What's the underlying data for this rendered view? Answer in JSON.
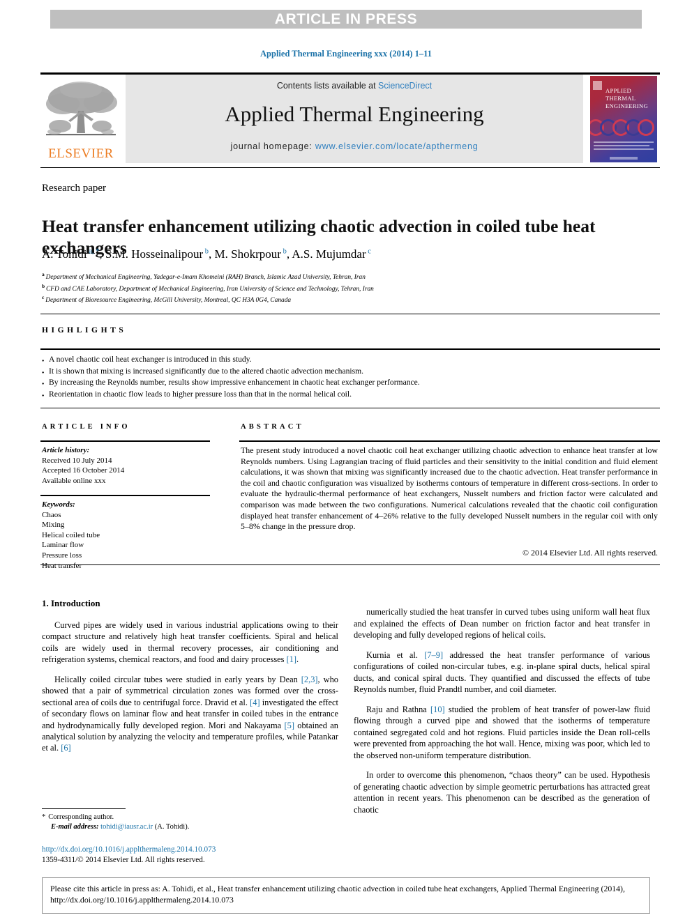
{
  "banner": {
    "text": "ARTICLE IN PRESS"
  },
  "journal_line": "Applied Thermal Engineering xxx (2014) 1–11",
  "masthead": {
    "elsevier_wordmark": "ELSEVIER",
    "contents_prefix": "Contents lists available at ",
    "contents_link": "ScienceDirect",
    "journal_title": "Applied Thermal Engineering",
    "homepage_prefix": "journal homepage: ",
    "homepage_url": "www.elsevier.com/locate/apthermeng",
    "cover_title_line1": "APPLIED",
    "cover_title_line2": "THERMAL",
    "cover_title_line3": "ENGINEERING"
  },
  "article": {
    "kicker": "Research paper",
    "title": "Heat transfer enhancement utilizing chaotic advection in coiled tube heat exchangers",
    "authors": [
      {
        "name": "A. Tohidi",
        "marks": "a, *"
      },
      {
        "name": "S.M. Hosseinalipour",
        "marks": "b"
      },
      {
        "name": "M. Shokrpour",
        "marks": "b"
      },
      {
        "name": "A.S. Mujumdar",
        "marks": "c"
      }
    ],
    "affiliations": [
      {
        "mark": "a",
        "text": "Department of Mechanical Engineering, Yadegar-e-Imam Khomeini (RAH) Branch, Islamic Azad University, Tehran, Iran"
      },
      {
        "mark": "b",
        "text": "CFD and CAE Laboratory, Department of Mechanical Engineering, Iran University of Science and Technology, Tehran, Iran"
      },
      {
        "mark": "c",
        "text": "Department of Bioresource Engineering, McGill University, Montreal, QC H3A 0G4, Canada"
      }
    ]
  },
  "highlights": {
    "heading": "HIGHLIGHTS",
    "items": [
      "A novel chaotic coil heat exchanger is introduced in this study.",
      "It is shown that mixing is increased significantly due to the altered chaotic advection mechanism.",
      "By increasing the Reynolds number, results show impressive enhancement in chaotic heat exchanger performance.",
      "Reorientation in chaotic flow leads to higher pressure loss than that in the normal helical coil."
    ]
  },
  "article_info": {
    "heading": "ARTICLE INFO",
    "history_label": "Article history:",
    "history": [
      "Received 10 July 2014",
      "Accepted 16 October 2014",
      "Available online xxx"
    ],
    "keywords_label": "Keywords:",
    "keywords": [
      "Chaos",
      "Mixing",
      "Helical coiled tube",
      "Laminar flow",
      "Pressure loss",
      "Heat transfer"
    ]
  },
  "abstract": {
    "heading": "ABSTRACT",
    "text": "The present study introduced a novel chaotic coil heat exchanger utilizing chaotic advection to enhance heat transfer at low Reynolds numbers. Using Lagrangian tracing of fluid particles and their sensitivity to the initial condition and fluid element calculations, it was shown that mixing was significantly increased due to the chaotic advection. Heat transfer performance in the coil and chaotic configuration was visualized by isotherms contours of temperature in different cross-sections. In order to evaluate the hydraulic-thermal performance of heat exchangers, Nusselt numbers and friction factor were calculated and comparison was made between the two configurations. Numerical calculations revealed that the chaotic coil configuration displayed heat transfer enhancement of 4–26% relative to the fully developed Nusselt numbers in the regular coil with only 5–8% change in the pressure drop.",
    "copyright": "© 2014 Elsevier Ltd. All rights reserved."
  },
  "body": {
    "section_heading": "1. Introduction",
    "left_paragraphs": [
      "Curved pipes are widely used in various industrial applications owing to their compact structure and relatively high heat transfer coefficients. Spiral and helical coils are widely used in thermal recovery processes, air conditioning and refrigeration systems, chemical reactors, and food and dairy processes [1].",
      "Helically coiled circular tubes were studied in early years by Dean [2,3], who showed that a pair of symmetrical circulation zones was formed over the cross-sectional area of coils due to centrifugal force. Dravid et al. [4] investigated the effect of secondary flows on laminar flow and heat transfer in coiled tubes in the entrance and hydrodynamically fully developed region. Mori and Nakayama [5] obtained an analytical solution by analyzing the velocity and temperature profiles, while Patankar et al. [6]"
    ],
    "right_paragraphs": [
      "numerically studied the heat transfer in curved tubes using uniform wall heat flux and explained the effects of Dean number on friction factor and heat transfer in developing and fully developed regions of helical coils.",
      "Kurnia et al. [7–9] addressed the heat transfer performance of various configurations of coiled non-circular tubes, e.g. in-plane spiral ducts, helical spiral ducts, and conical spiral ducts. They quantified and discussed the effects of tube Reynolds number, fluid Prandtl number, and coil diameter.",
      "Raju and Rathna [10] studied the problem of heat transfer of power-law fluid flowing through a curved pipe and showed that the isotherms of temperature contained segregated cold and hot regions. Fluid particles inside the Dean roll-cells were prevented from approaching the hot wall. Hence, mixing was poor, which led to the observed non-uniform temperature distribution.",
      "In order to overcome this phenomenon, “chaos theory” can be used. Hypothesis of generating chaotic advection by simple geometric perturbations has attracted great attention in recent years. This phenomenon can be described as the generation of chaotic"
    ]
  },
  "footnote": {
    "corresponding": "Corresponding author.",
    "email_label": "E-mail address:",
    "email": "tohidi@iausr.ac.ir",
    "email_suffix": "(A. Tohidi)."
  },
  "doi_block": {
    "doi_url": "http://dx.doi.org/10.1016/j.applthermaleng.2014.10.073",
    "issn_line": "1359-4311/© 2014 Elsevier Ltd. All rights reserved."
  },
  "cite_box": {
    "text": "Please cite this article in press as: A. Tohidi, et al., Heat transfer enhancement utilizing chaotic advection in coiled tube heat exchangers, Applied Thermal Engineering (2014), http://dx.doi.org/10.1016/j.applthermaleng.2014.10.073"
  },
  "colors": {
    "link": "#1b72a8",
    "banner_bg": "#bfbfbf",
    "elsevier_orange": "#ec7d23",
    "masthead_bg": "#e6e6e6"
  }
}
